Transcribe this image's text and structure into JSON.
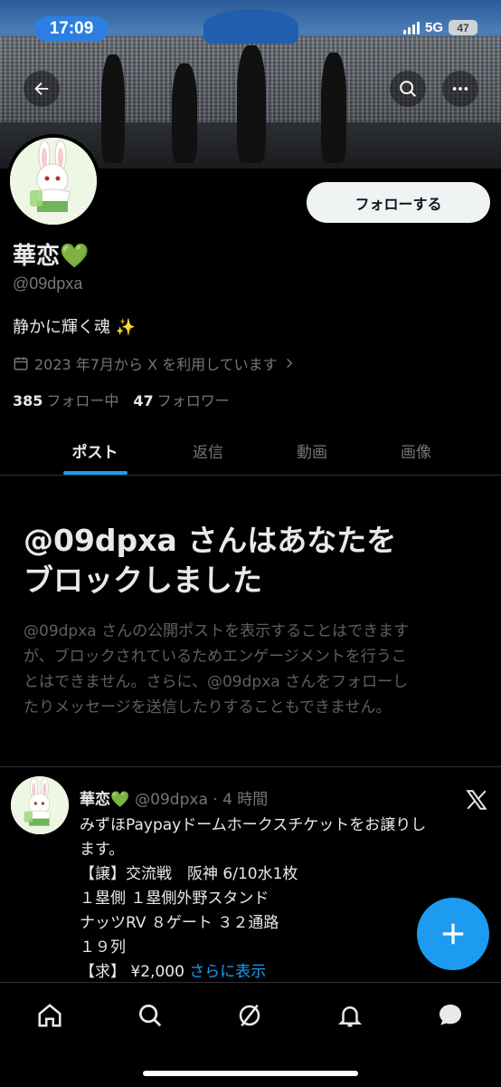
{
  "status_bar": {
    "time": "17:09",
    "network": "5G",
    "battery": "47"
  },
  "header": {
    "back_icon": "arrow-left-icon",
    "search_icon": "search-icon",
    "more_icon": "more-horizontal-icon"
  },
  "profile": {
    "name": "華恋💚",
    "handle": "@09dpxa",
    "bio": "静かに輝く魂 ✨",
    "joined": "2023 年7月から X を利用しています",
    "following_count": "385",
    "following_label": "フォロー中",
    "followers_count": "47",
    "followers_label": "フォロワー",
    "follow_button": "フォローする"
  },
  "tabs": [
    {
      "label": "ポスト",
      "active": true
    },
    {
      "label": "返信",
      "active": false
    },
    {
      "label": "動画",
      "active": false
    },
    {
      "label": "画像",
      "active": false
    }
  ],
  "blocked": {
    "title_line1": "@09dpxa さんはあなたを",
    "title_line2": "ブロックしました",
    "description_lines": [
      "@09dpxa さんの公開ポストを表示することはできます",
      "が、ブロックされているためエンゲージメントを行うこ",
      "とはできません。さらに、@09dpxa さんをフォローし",
      "たりメッセージを送信したりすることもできません。"
    ]
  },
  "post": {
    "name": "華恋💚",
    "meta": "@09dpxa · 4 時間",
    "lines": [
      "みずほPaypayドームホークスチケットをお譲りし",
      "ます。",
      "【譲】交流戦　阪神 6/10水1枚",
      "１塁側 １塁側外野スタンド",
      "ナッツRV ８ゲート ３２通路",
      "１９列"
    ],
    "last_line": "【求】 ¥2,000 ",
    "show_more": "さらに表示"
  },
  "colors": {
    "accent": "#1d9bf0",
    "background": "#000000",
    "muted": "#71767b"
  },
  "bottom_nav": [
    "home-icon",
    "search-icon",
    "grok-icon",
    "notifications-icon",
    "messages-icon"
  ]
}
